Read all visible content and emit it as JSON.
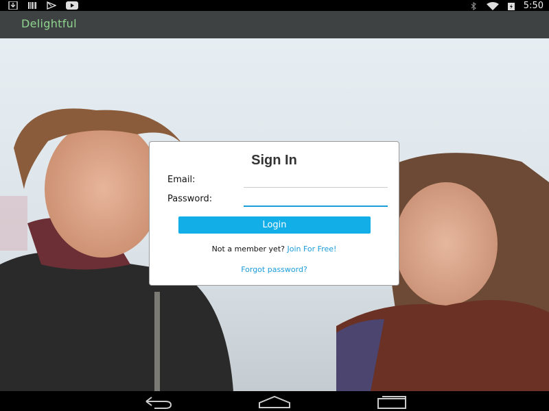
{
  "status_bar": {
    "time": "5:50",
    "left_icons": [
      "download-icon",
      "barcode-icon",
      "play-store-icon",
      "youtube-icon"
    ],
    "right_icons": [
      "bluetooth-icon",
      "wifi-icon",
      "battery-icon"
    ]
  },
  "app_bar": {
    "title": "Delightful",
    "title_color": "#8fd58f"
  },
  "sign_in": {
    "title": "Sign In",
    "email_label": "Email:",
    "email_value": "",
    "password_label": "Password:",
    "password_value": "",
    "login_label": "Login",
    "not_member_text": "Not a member yet?",
    "join_link": "Join For Free!",
    "forgot_link": "Forgot password?",
    "accent_color": "#12aee8"
  },
  "nav_bar": {
    "buttons": [
      "back-icon",
      "home-icon",
      "recents-icon"
    ]
  }
}
